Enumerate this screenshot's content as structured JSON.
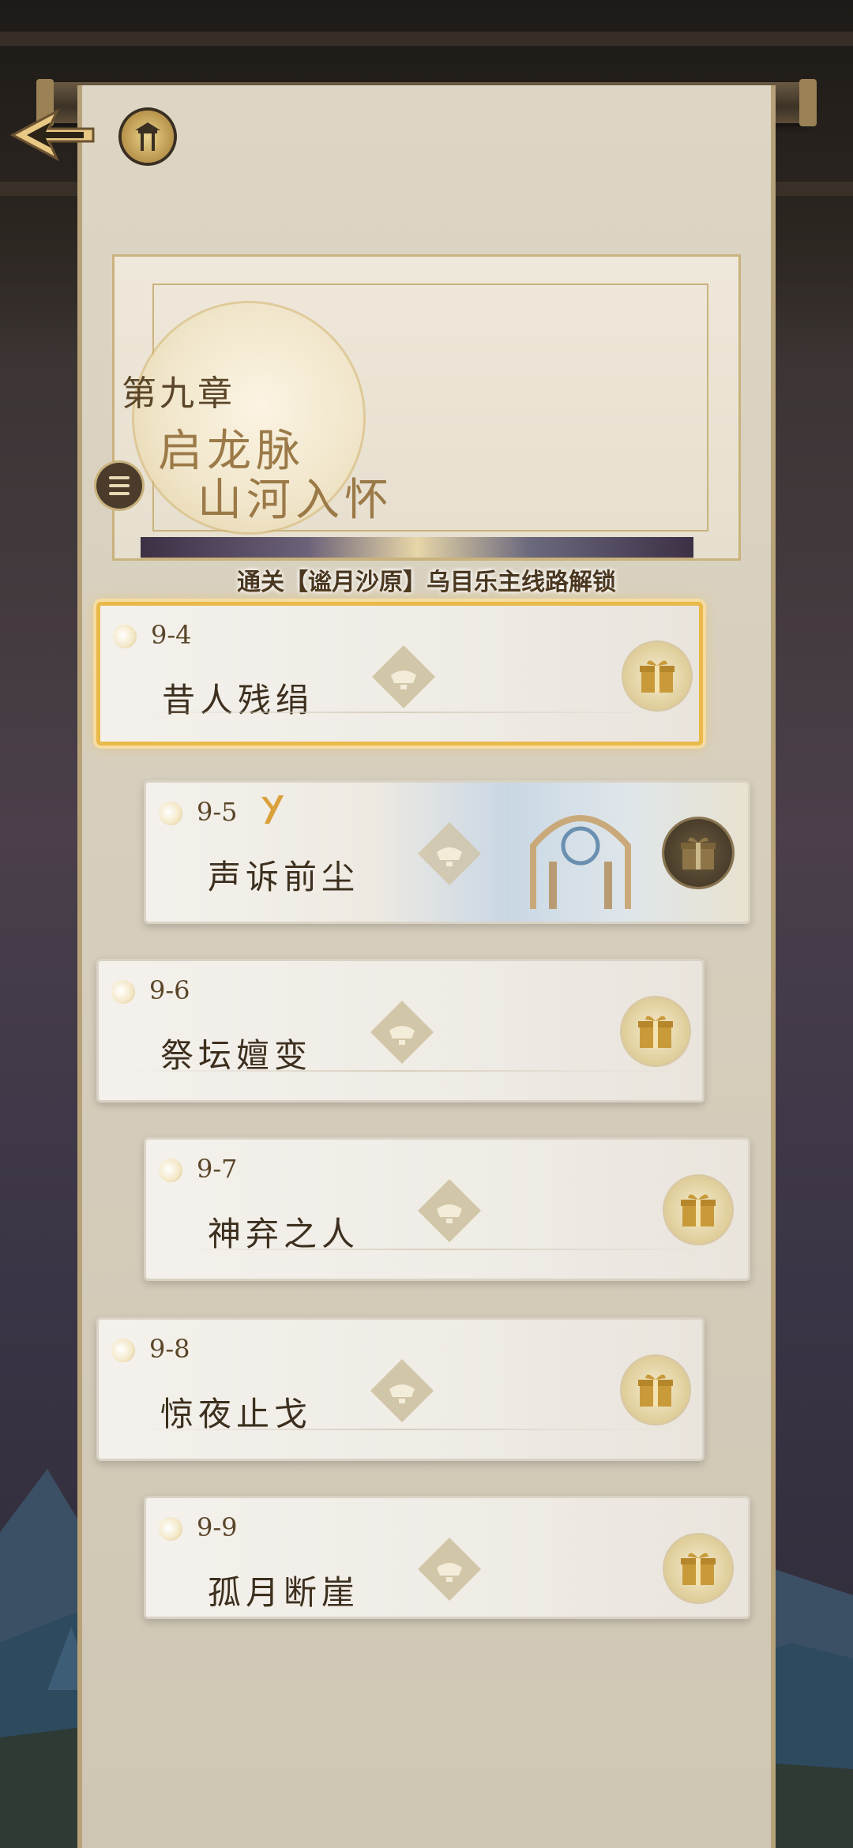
{
  "chapter": {
    "label": "第九章",
    "title_line1": "启龙脉",
    "title_line2": "山河入怀",
    "unlock_text": "通关【谧月沙原】乌目乐主线路解锁"
  },
  "levels": [
    {
      "code": "9-4",
      "name": "昔人残绢",
      "active": true
    },
    {
      "code": "9-5",
      "name": "声诉前尘",
      "has_bonus_badge": true
    },
    {
      "code": "9-6",
      "name": "祭坛嬗变"
    },
    {
      "code": "9-7",
      "name": "神弃之人"
    },
    {
      "code": "9-8",
      "name": "惊夜止戈"
    },
    {
      "code": "9-9",
      "name": "孤月断崖"
    }
  ],
  "icons": {
    "back": "back-arrow-icon",
    "home": "pavilion-icon",
    "menu": "menu-icon",
    "node": "lotus-node-icon",
    "reward": "gift-box-icon"
  },
  "colors": {
    "accent_gold": "#e9b94a",
    "parchment": "#ded6c4",
    "text_dark": "#3d2f1e"
  }
}
